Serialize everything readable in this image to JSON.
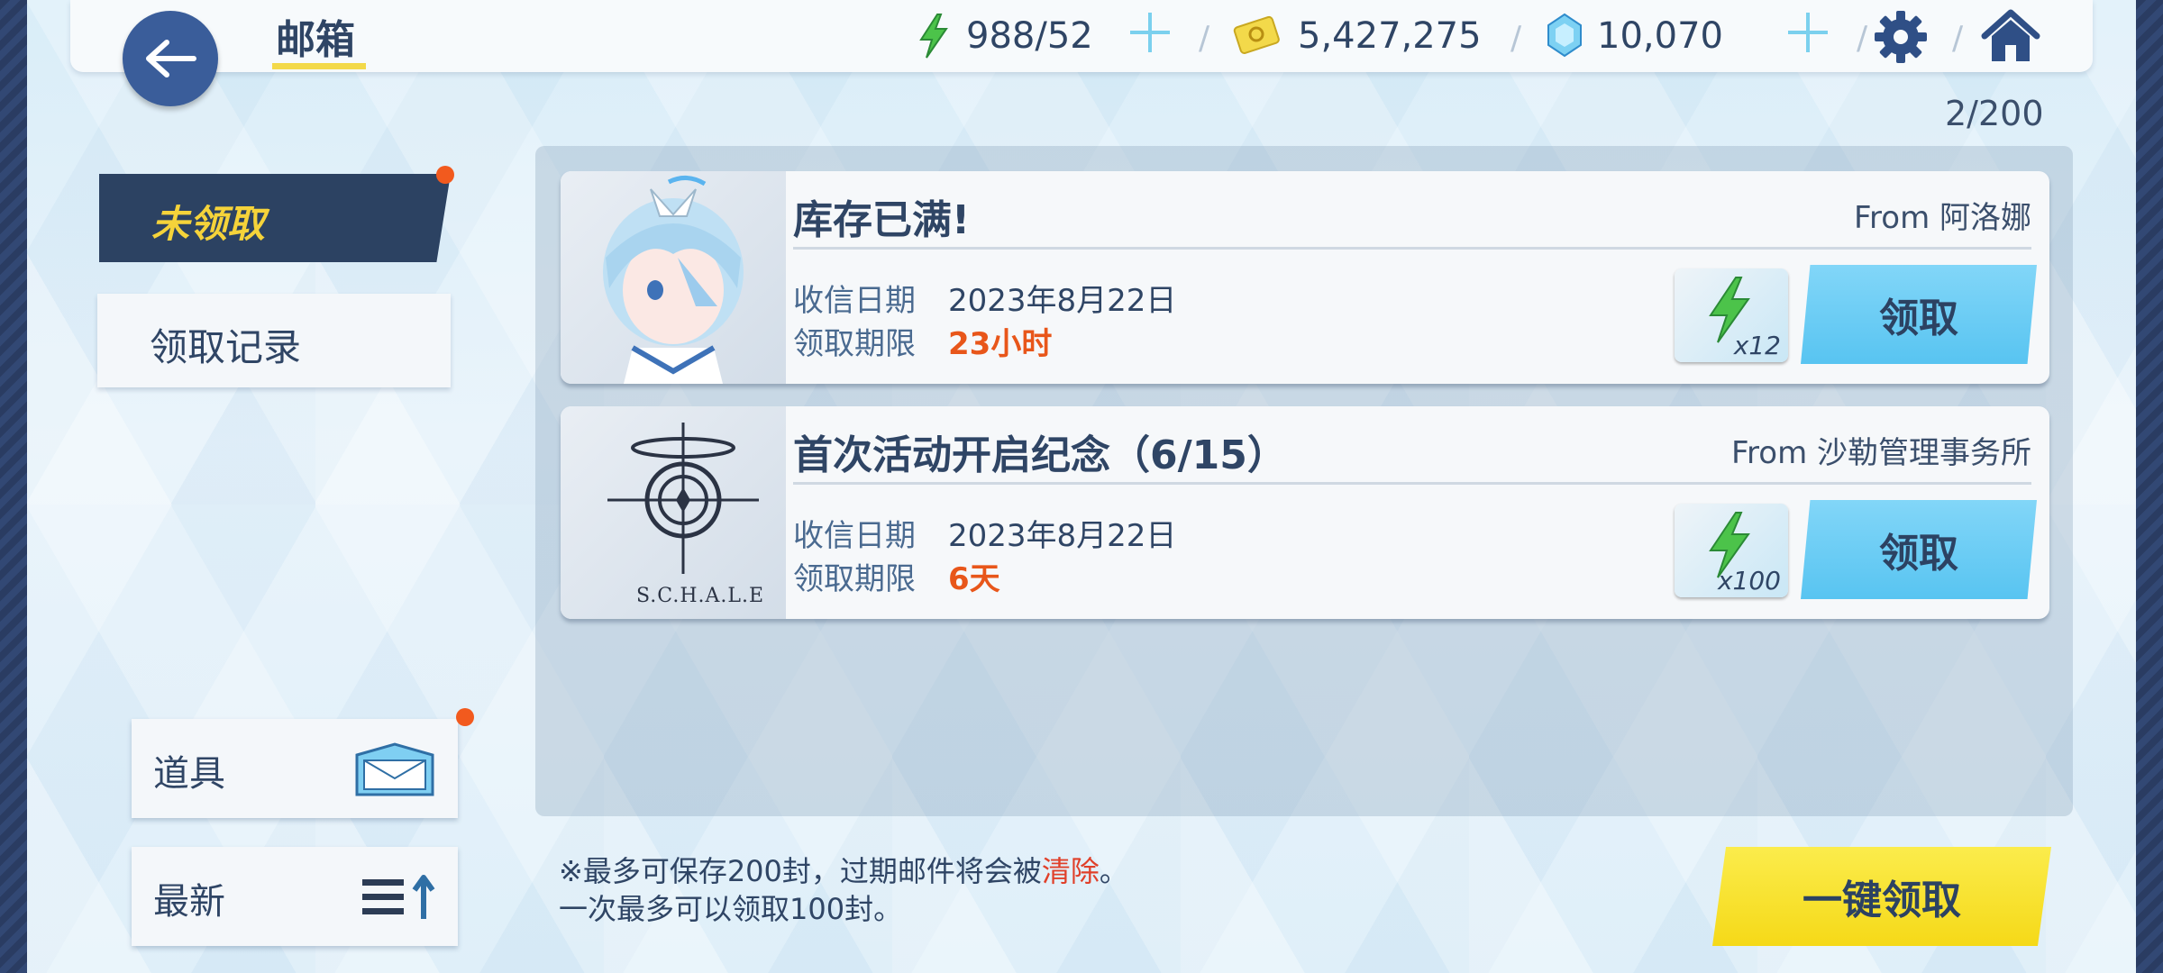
{
  "header": {
    "title": "邮箱",
    "energy": "988/52",
    "credits": "5,427,275",
    "gems": "10,070"
  },
  "mail_count": "2/200",
  "tabs": [
    {
      "label": "未领取",
      "active": true
    },
    {
      "label": "领取记录",
      "active": false
    }
  ],
  "side_buttons": {
    "items_label": "道具",
    "sort_label": "最新"
  },
  "mails": [
    {
      "subject": "库存已满!",
      "from": "From 阿洛娜",
      "received_key": "收信日期",
      "received_date": "2023年8月22日",
      "deadline_key": "领取期限",
      "deadline": "23小时",
      "reward_qty": "x12",
      "claim_label": "领取"
    },
    {
      "subject": "首次活动开启纪念（6/15）",
      "from": "From 沙勒管理事务所",
      "received_key": "收信日期",
      "received_date": "2023年8月22日",
      "deadline_key": "领取期限",
      "deadline": "6天",
      "reward_qty": "x100",
      "claim_label": "领取",
      "logo_text": "S.C.H.A.L.E"
    }
  ],
  "footer": {
    "note_line1_pre": "※最多可保存200封，过期邮件将会被",
    "note_line1_red": "清除",
    "note_line1_post": "。",
    "note_line2": "一次最多可以领取100封。",
    "claim_all_label": "一键领取"
  },
  "colors": {
    "accent_navy": "#2c4262",
    "claim_blue": "#58c4f1",
    "claim_all_yellow": "#f5d918",
    "deadline_orange": "#e8561a",
    "notify_dot": "#f25a1e"
  }
}
